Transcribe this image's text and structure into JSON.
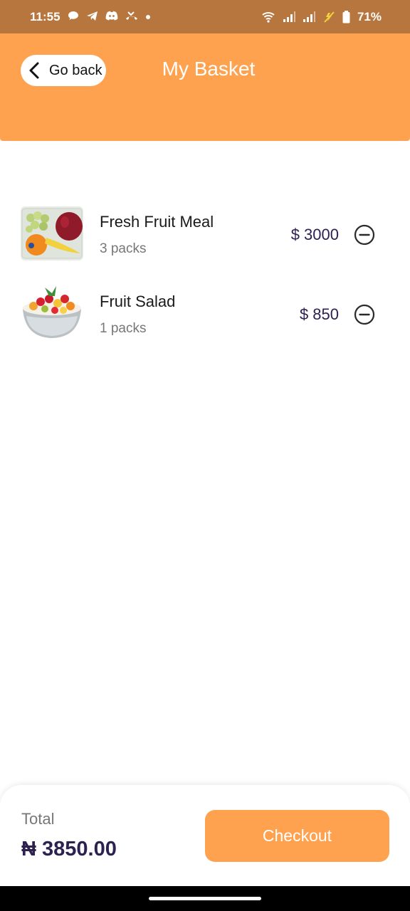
{
  "status_bar": {
    "time": "11:55",
    "battery": "71%",
    "icons_left": [
      "chat-icon",
      "telegram-icon",
      "discord-icon",
      "missed-call-icon",
      "dot-icon"
    ],
    "icons_right": [
      "wifi-icon",
      "signal-icon",
      "signal-icon",
      "charging-icon",
      "battery-icon"
    ]
  },
  "header": {
    "back_label": "Go back",
    "title": "My Basket"
  },
  "items": [
    {
      "name": "Fresh Fruit Meal",
      "qty": "3 packs",
      "price": "$ 3000",
      "thumb_icon": "fruit-meal-image"
    },
    {
      "name": "Fruit Salad",
      "qty": "1 packs",
      "price": "$ 850",
      "thumb_icon": "fruit-salad-image"
    }
  ],
  "footer": {
    "total_label": "Total",
    "total_value": "₦ 3850.00",
    "checkout_label": "Checkout"
  },
  "colors": {
    "accent": "#ffa24f",
    "status_bar": "#b8763f",
    "price_text": "#2d2150"
  }
}
